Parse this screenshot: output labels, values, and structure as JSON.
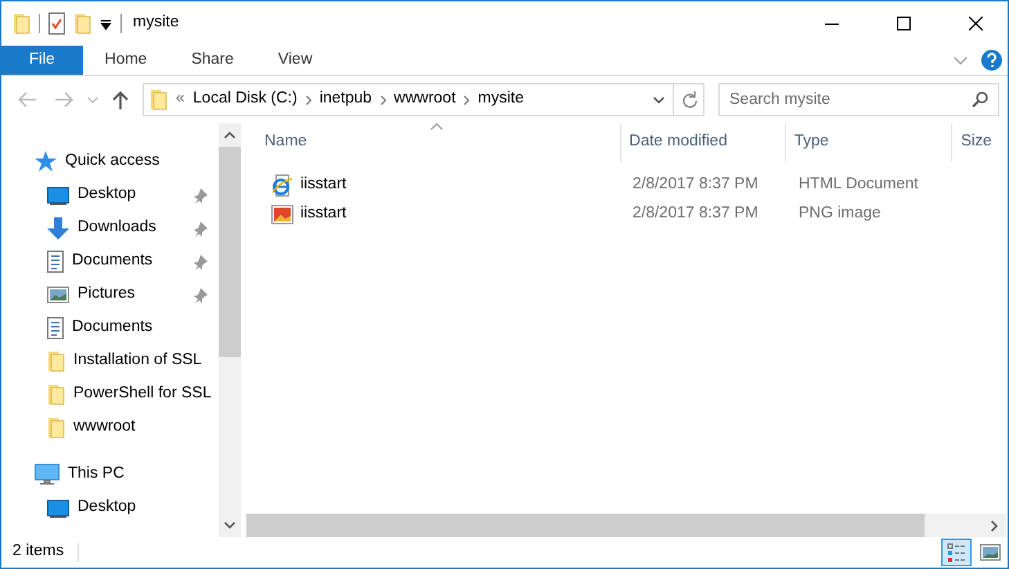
{
  "window": {
    "title": "mysite"
  },
  "ribbon_tabs": [
    {
      "label": "File",
      "selected": true
    },
    {
      "label": "Home",
      "selected": false
    },
    {
      "label": "Share",
      "selected": false
    },
    {
      "label": "View",
      "selected": false
    }
  ],
  "address_bar": {
    "overflow": "«",
    "segments": [
      "Local Disk (C:)",
      "inetpub",
      "wwwroot",
      "mysite"
    ]
  },
  "search": {
    "placeholder": "Search mysite"
  },
  "sidebar": {
    "items": [
      {
        "label": "Quick access",
        "kind": "quick",
        "children": [
          {
            "label": "Desktop",
            "kind": "desktop",
            "pinned": true
          },
          {
            "label": "Downloads",
            "kind": "downloads",
            "pinned": true
          },
          {
            "label": "Documents",
            "kind": "document",
            "pinned": true
          },
          {
            "label": "Pictures",
            "kind": "pictures",
            "pinned": true
          },
          {
            "label": "Documents",
            "kind": "document",
            "pinned": false
          },
          {
            "label": "Installation of SSL",
            "kind": "folder",
            "pinned": false
          },
          {
            "label": "PowerShell for SSL",
            "kind": "folder",
            "pinned": false
          },
          {
            "label": "wwwroot",
            "kind": "folder",
            "pinned": false
          }
        ]
      },
      {
        "label": "This PC",
        "kind": "pc",
        "children": [
          {
            "label": "Desktop",
            "kind": "desktop",
            "pinned": false
          }
        ]
      }
    ]
  },
  "table": {
    "columns": [
      "Name",
      "Date modified",
      "Type",
      "Size"
    ],
    "rows": [
      {
        "kind": "html",
        "name": "iisstart",
        "date": "2/8/2017 8:37 PM",
        "type": "HTML Document"
      },
      {
        "kind": "png",
        "name": "iisstart",
        "date": "2/8/2017 8:37 PM",
        "type": "PNG image"
      }
    ]
  },
  "status_bar": {
    "text": "2 items",
    "views": [
      {
        "kind": "details",
        "selected": true
      },
      {
        "kind": "large",
        "selected": false
      }
    ]
  }
}
